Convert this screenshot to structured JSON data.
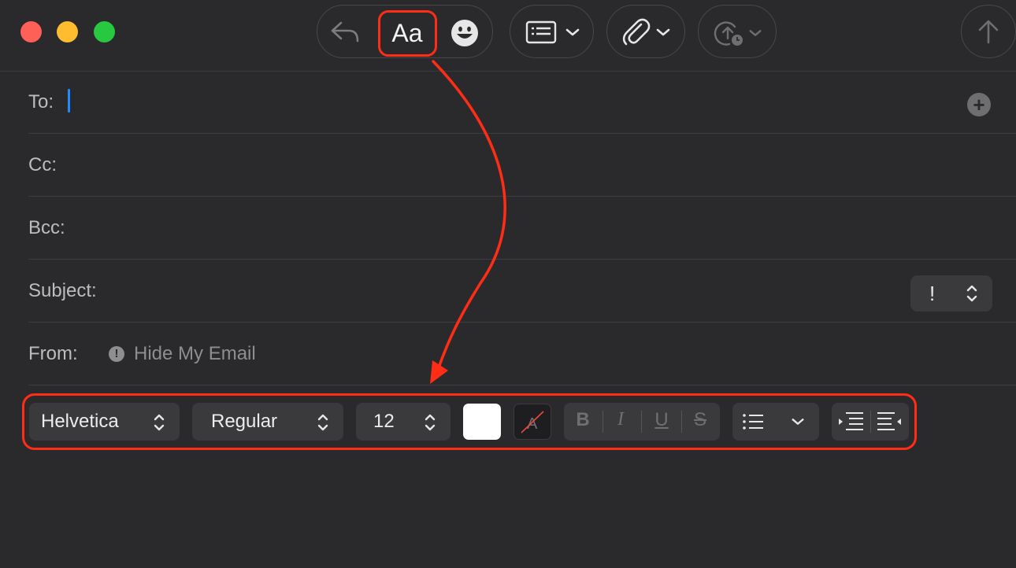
{
  "fields": {
    "to_label": "To:",
    "cc_label": "Cc:",
    "bcc_label": "Bcc:",
    "subject_label": "Subject:",
    "from_label": "From:",
    "from_value": "Hide My Email",
    "priority_symbol": "!"
  },
  "toolbar": {
    "format_label": "Aa"
  },
  "format_bar": {
    "font_family": "Helvetica",
    "font_style": "Regular",
    "font_size": "12",
    "bold": "B",
    "italic": "I",
    "underline": "U",
    "strikethrough": "S"
  },
  "colors": {
    "window_bg": "#2a2a2c",
    "annotation_red": "#ff2d16",
    "caret_blue": "#1e8cff"
  },
  "icons": [
    "reply-icon",
    "emoji-icon",
    "header-fields-icon",
    "attachment-icon",
    "send-later-icon",
    "send-icon",
    "add-contact-icon",
    "info-icon",
    "list-icon",
    "indent-icon",
    "outdent-icon"
  ]
}
